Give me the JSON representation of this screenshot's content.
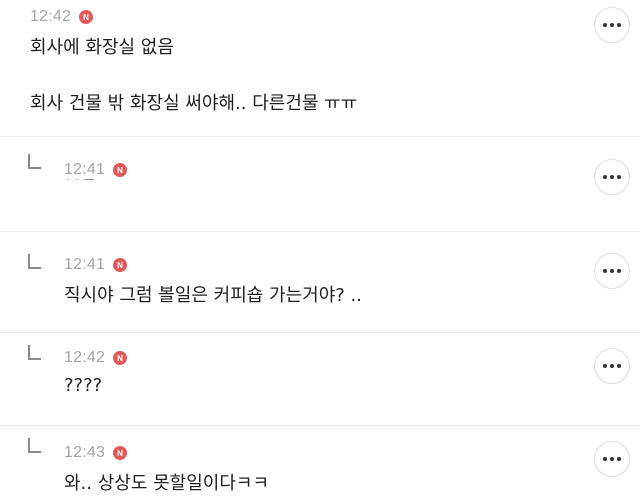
{
  "badge_label": "N",
  "comments": [
    {
      "time": "12:42",
      "lines": [
        "회사에 화장실 없음",
        "회사 건물 밖 화장실 써야해.. 다른건물 ㅠㅠ"
      ]
    },
    {
      "time": "12:41",
      "text": "ㅅㅂ"
    },
    {
      "time": "12:41",
      "text": "직시야 그럼 볼일은 커피숍 가는거야? .."
    },
    {
      "time": "12:42",
      "text": "????"
    },
    {
      "time": "12:43",
      "text": "와.. 상상도 못할일이다ㅋㅋ"
    }
  ],
  "colors": {
    "badge": "#e05a5a",
    "timestamp": "#a5a5a5",
    "divider": "#e9e9e9"
  }
}
